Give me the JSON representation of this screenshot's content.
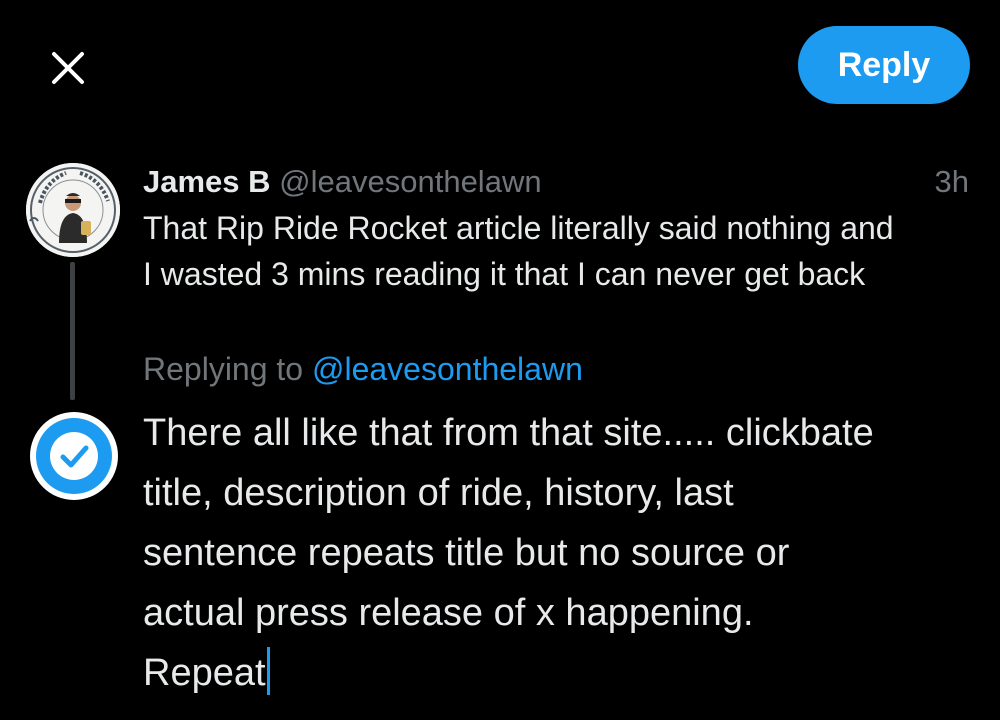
{
  "toolbar": {
    "close_icon": "close-icon",
    "reply_label": "Reply",
    "accent_color": "#1d9bf0"
  },
  "original_tweet": {
    "author_name": "James B",
    "author_handle": "@leavesonthelawn",
    "timestamp": "3h",
    "text_lines": [
      "That Rip Ride Rocket article literally said nothing and",
      "I wasted 3 mins reading it that I can never get back"
    ]
  },
  "reply_context": {
    "label": "Replying to",
    "handle": "@leavesonthelawn"
  },
  "composer": {
    "avatar_icon": "verified-check-icon",
    "text_lines": [
      "There all like that from that site..... clickbate",
      "title, description of ride, history, last",
      "sentence repeats title but no source or",
      "actual press release of x happening.",
      "Repeat"
    ]
  }
}
